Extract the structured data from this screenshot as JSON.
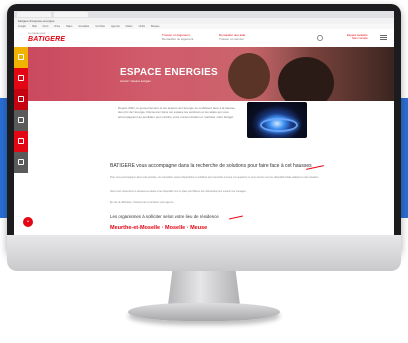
{
  "browser": {
    "address": "batigere.fr/espace-energies",
    "bookmarks": [
      "Google",
      "Mail",
      "Docs",
      "Drive",
      "Maps",
      "Actualités",
      "YouTube",
      "Agenda",
      "Météo",
      "Outils",
      "Banque"
    ]
  },
  "header": {
    "logo_top": "Le réseau pour",
    "logo_main": "BATIGERE",
    "link1": {
      "title": "Trouver un logement",
      "sub": "Demander un logement"
    },
    "link2": {
      "title": "Demander une aide",
      "sub": "Trouver un service"
    },
    "espace_label": "Espace locataire",
    "espace_sub": "Mon compte"
  },
  "sidenav": [
    {
      "label": "",
      "color": "#f0b400"
    },
    {
      "label": "",
      "color": "#e30613"
    },
    {
      "label": "",
      "color": "#c40511"
    },
    {
      "label": "",
      "color": "#5a5a5a"
    },
    {
      "label": "",
      "color": "#e30613"
    },
    {
      "label": "",
      "color": "#5a5a5a"
    }
  ],
  "hero": {
    "title": "ESPACE ENERGIES",
    "breadcrumb": "Accueil > Espace énergies"
  },
  "content": {
    "intro": "Depuis 2021, le gouvernement et les acteurs de l'énergie se mobilisent face à la hausse des prix de l'énergie. Découvrez dans cet espace les solutions et les aides qui vous accompagnent au quotidien pour réduire votre consommation et maîtriser votre budget.",
    "subtitle": "BATIGERE vous accompagne dans la recherche de solutions pour faire face à cet hausses",
    "para1": "Pour vous accompagner dans cette période, nos conseillers restent disponibles et mobilisés pour répondre à toutes vos questions et vous orienter vers les dispositifs d'aide adaptés à votre situation.",
    "para2": "Nous vous présentons ci-dessous les aides et les dispositifs mis en place par l'État et les collectivités pour soutenir les ménages.",
    "para3": "En cas de difficultés, n'hésitez pas à contacter votre agence.",
    "subtitle2": "Les organismes à solliciter selon votre lieu de résidence",
    "red_heading": "Meurthe-et-Moselle · Moselle · Meuse"
  },
  "colors": {
    "accent": "#e30613",
    "backdrop": "#2b6fd6"
  }
}
